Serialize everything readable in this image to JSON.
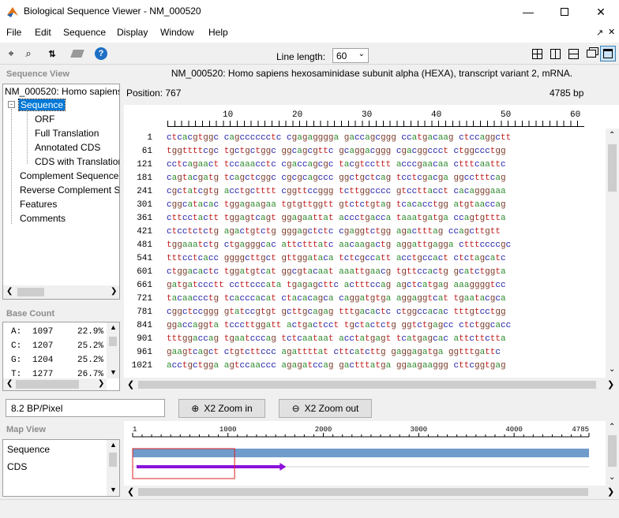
{
  "window": {
    "title": "Biological Sequence Viewer - NM_000520"
  },
  "menu": [
    "File",
    "Edit",
    "Sequence",
    "Display",
    "Window",
    "Help"
  ],
  "toolbar": {
    "line_length_label": "Line length:",
    "line_length_value": "60"
  },
  "sequence_view": {
    "header": "Sequence View",
    "tree": {
      "root": "NM_000520: Homo sapiens",
      "sequence": "Sequence",
      "orf": "ORF",
      "full_translation": "Full Translation",
      "annotated_cds": "Annotated CDS",
      "cds_translation": "CDS with Translation",
      "complement": "Complement Sequence",
      "reverse_complement": "Reverse Complement Se",
      "features": "Features",
      "comments": "Comments"
    }
  },
  "base_count": {
    "header": "Base Count",
    "rows": [
      {
        "base": "A:",
        "count": "1097",
        "pct": "22.9%"
      },
      {
        "base": "C:",
        "count": "1207",
        "pct": "25.2%"
      },
      {
        "base": "G:",
        "count": "1204",
        "pct": "25.2%"
      },
      {
        "base": "T:",
        "count": "1277",
        "pct": "26.7%"
      }
    ]
  },
  "main": {
    "title": "NM_000520: Homo sapiens hexosaminidase subunit alpha (HEXA), transcript variant 2, mRNA.",
    "position": "Position: 767",
    "length": "4785 bp",
    "ruler": [
      "10",
      "20",
      "30",
      "40",
      "50",
      "60"
    ],
    "rows": [
      {
        "n": "1",
        "s": "ctcacgtggc cagcccccctc cgagagggga gaccagcggg ccatgacaag ctccaggctt"
      },
      {
        "n": "61",
        "s": "tggttttcgc tgctgctggc ggcagcgttc gcaggacggg cgacggccct ctggccctgg"
      },
      {
        "n": "121",
        "s": "cctcagaact tccaaacctc cgaccagcgc tacgtccttt acccgaacaa ctttcaattc"
      },
      {
        "n": "181",
        "s": "cagtacgatg tcagctcggc cgcgcagccc ggctgctcag tcctcgacga ggcctttcag"
      },
      {
        "n": "241",
        "s": "cgctatcgtg acctgctttt cggttccggg tcttggcccc gtccttacct cacagggaaa"
      },
      {
        "n": "301",
        "s": "cggcatacac tggagaagaa tgtgttggtt gtctctgtag tcacacctgg atgtaaccag"
      },
      {
        "n": "361",
        "s": "cttcctactt tggagtcagt ggagaattat accctgacca taaatgatga ccagtgttta"
      },
      {
        "n": "421",
        "s": "ctcctctctg agactgtctg gggagctctc cgaggtctgg agactttag ccagcttgtt"
      },
      {
        "n": "481",
        "s": "tggaaatctg ctgagggcac attctttatc aacaagactg aggattgagga ctttccccgc"
      },
      {
        "n": "541",
        "s": "tttcctcacc ggggcttgct gttggataca tctcgccatt acctgccact ctctagcatc"
      },
      {
        "n": "601",
        "s": "ctggacactc tggatgtcat ggcgtacaat aaattgaacg tgttccactg gcatctggta"
      },
      {
        "n": "661",
        "s": "gatgatccctt ccttcccata tgagagcttc actttccag agctcatgag aaaggggtcc"
      },
      {
        "n": "721",
        "s": "tacaaccctg tcacccacat ctacacagca caggatgtga aggaggtcat tgaatacgca"
      },
      {
        "n": "781",
        "s": "cggctccggg gtatccgtgt gcttgcagag tttgacactc ctggccacac tttgtcctgg"
      },
      {
        "n": "841",
        "s": "ggaccaggta tcccttggatt actgactcct tgctactctg ggtctgagcc ctctggcacc"
      },
      {
        "n": "901",
        "s": "tttggaccag tgaatcccag tctcaataat acctatgagt tcatgagcac attcttctta"
      },
      {
        "n": "961",
        "s": "gaagtcagct ctgtcttccc agattttat cttcatcttg gaggagatga ggtttgattc"
      },
      {
        "n": "1021",
        "s": "acctgctgga agtccaaccc agagatccag gactttatga ggaagaaggg cttcggtgag"
      }
    ]
  },
  "zoom": {
    "value": "8.2 BP/Pixel",
    "zoom_in": "X2 Zoom in",
    "zoom_out": "X2 Zoom out"
  },
  "map_view": {
    "header": "Map View",
    "tracks": [
      "Sequence",
      "CDS"
    ],
    "ruler": [
      "1",
      "1000",
      "2000",
      "3000",
      "4000",
      "4785"
    ],
    "sequence_length": 4785,
    "cds_start": 1,
    "cds_end": 1610,
    "viewport_start": 1,
    "viewport_end": 1070,
    "colors": {
      "sequence_bar": "#6f9ccb",
      "cds_arrow": "#8b11d9",
      "viewport": "#e02020"
    }
  }
}
